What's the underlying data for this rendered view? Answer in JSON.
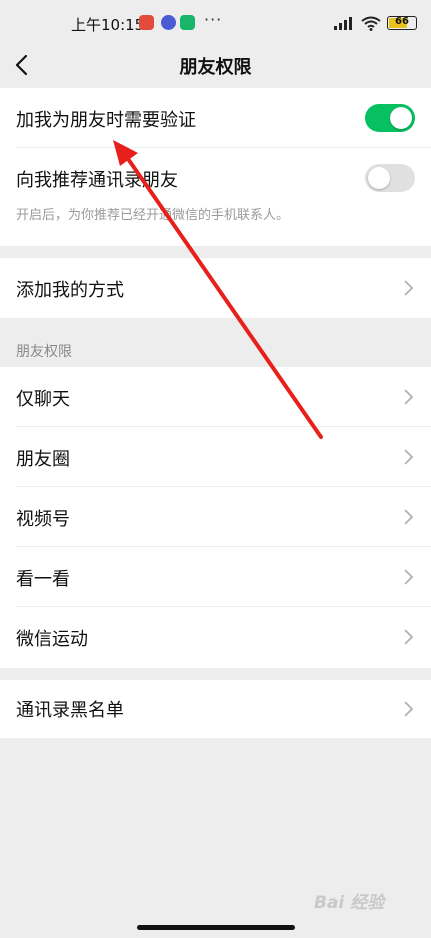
{
  "status_bar": {
    "time": "上午10:15",
    "dots": "···",
    "battery": "66"
  },
  "nav": {
    "title": "朋友权限"
  },
  "verification": {
    "add_verify_label": "加我为朋友时需要验证",
    "add_verify_on": true,
    "recommend_contacts_label": "向我推荐通讯录朋友",
    "recommend_contacts_on": false,
    "recommend_hint": "开启后，为你推荐已经开通微信的手机联系人。"
  },
  "add_methods": {
    "label": "添加我的方式"
  },
  "permissions": {
    "header": "朋友权限",
    "items": [
      {
        "label": "仅聊天"
      },
      {
        "label": "朋友圈"
      },
      {
        "label": "视频号"
      },
      {
        "label": "看一看"
      },
      {
        "label": "微信运动"
      }
    ]
  },
  "blacklist": {
    "label": "通讯录黑名单"
  },
  "watermark": {
    "text": "Bai 经验"
  },
  "colors": {
    "toggle_on": "#07c160",
    "toggle_off": "#e0e0e0",
    "annotation_arrow": "#e8201c",
    "background": "#ededed"
  }
}
